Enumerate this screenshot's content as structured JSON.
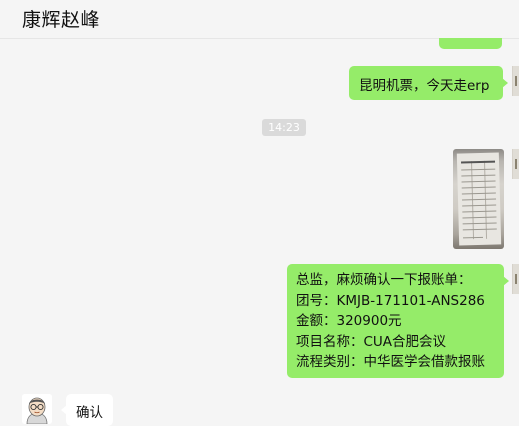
{
  "chat": {
    "title": "康辉赵峰",
    "timestamp": "14:23"
  },
  "messages": {
    "msg1": "昆明机票，今天走erp",
    "msg2": {
      "line1": "总监，麻烦确认一下报账单：",
      "line2": "团号：KMJB-171101-ANS286",
      "line3": "金额：320900元",
      "line4": "项目名称：CUA合肥会议",
      "line5": "流程类别：中华医学会借款报账"
    },
    "reply": "确认"
  },
  "colors": {
    "background": "#f5f5f5",
    "sent_bubble": "#95ec69",
    "received_bubble": "#ffffff",
    "timestamp_bg": "#dadada"
  }
}
